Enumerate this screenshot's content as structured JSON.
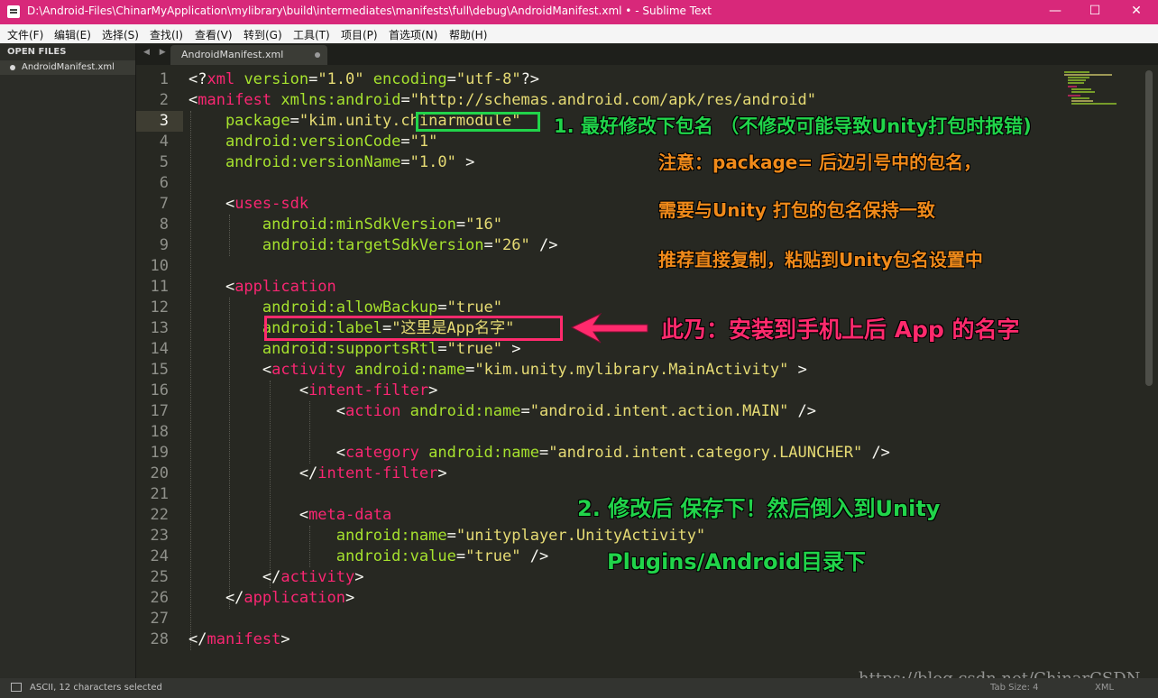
{
  "window": {
    "title": "D:\\Android-Files\\ChinarMyApplication\\mylibrary\\build\\intermediates\\manifests\\full\\debug\\AndroidManifest.xml • - Sublime Text",
    "minimize": "—",
    "maximize": "☐",
    "close": "✕"
  },
  "menu": {
    "items": [
      "文件(F)",
      "编辑(E)",
      "选择(S)",
      "查找(I)",
      "查看(V)",
      "转到(G)",
      "工具(T)",
      "项目(P)",
      "首选项(N)",
      "帮助(H)"
    ]
  },
  "sidebar": {
    "header": "OPEN FILES",
    "file": "AndroidManifest.xml"
  },
  "tabs": {
    "nav": "◀ ▶",
    "active": "AndroidManifest.xml"
  },
  "editor": {
    "line_numbers": [
      "1",
      "2",
      "3",
      "4",
      "5",
      "6",
      "7",
      "8",
      "9",
      "10",
      "11",
      "12",
      "13",
      "14",
      "15",
      "16",
      "17",
      "18",
      "19",
      "20",
      "21",
      "22",
      "23",
      "24",
      "25",
      "26",
      "27",
      "28"
    ],
    "current_line": "3",
    "lines": [
      [
        [
          "p",
          "<?"
        ],
        [
          "t",
          "xml"
        ],
        [
          "a",
          " version"
        ],
        [
          "p",
          "="
        ],
        [
          "s",
          "\"1.0\""
        ],
        [
          "a",
          " encoding"
        ],
        [
          "p",
          "="
        ],
        [
          "s",
          "\"utf-8\""
        ],
        [
          "p",
          "?>"
        ]
      ],
      [
        [
          "p",
          "<"
        ],
        [
          "t",
          "manifest"
        ],
        [
          "a",
          " xmlns:android"
        ],
        [
          "p",
          "="
        ],
        [
          "s",
          "\"http://schemas.android.com/apk/res/android\""
        ]
      ],
      [
        [
          "a",
          "    package"
        ],
        [
          "p",
          "="
        ],
        [
          "s",
          "\"kim.unity.chinarmodule\""
        ]
      ],
      [
        [
          "a",
          "    android:versionCode"
        ],
        [
          "p",
          "="
        ],
        [
          "s",
          "\"1\""
        ]
      ],
      [
        [
          "a",
          "    android:versionName"
        ],
        [
          "p",
          "="
        ],
        [
          "s",
          "\"1.0\""
        ],
        [
          "p",
          " >"
        ]
      ],
      [
        [
          "p",
          ""
        ]
      ],
      [
        [
          "p",
          "    <"
        ],
        [
          "t",
          "uses-sdk"
        ]
      ],
      [
        [
          "a",
          "        android:minSdkVersion"
        ],
        [
          "p",
          "="
        ],
        [
          "s",
          "\"16\""
        ]
      ],
      [
        [
          "a",
          "        android:targetSdkVersion"
        ],
        [
          "p",
          "="
        ],
        [
          "s",
          "\"26\""
        ],
        [
          "p",
          " />"
        ]
      ],
      [
        [
          "p",
          ""
        ]
      ],
      [
        [
          "p",
          "    <"
        ],
        [
          "t",
          "application"
        ]
      ],
      [
        [
          "a",
          "        android:allowBackup"
        ],
        [
          "p",
          "="
        ],
        [
          "s",
          "\"true\""
        ]
      ],
      [
        [
          "a",
          "        android:label"
        ],
        [
          "p",
          "="
        ],
        [
          "s",
          "\"这里是App名字\""
        ]
      ],
      [
        [
          "a",
          "        android:supportsRtl"
        ],
        [
          "p",
          "="
        ],
        [
          "s",
          "\"true\""
        ],
        [
          "p",
          " >"
        ]
      ],
      [
        [
          "p",
          "        <"
        ],
        [
          "t",
          "activity"
        ],
        [
          "a",
          " android:name"
        ],
        [
          "p",
          "="
        ],
        [
          "s",
          "\"kim.unity.mylibrary.MainActivity\""
        ],
        [
          "p",
          " >"
        ]
      ],
      [
        [
          "p",
          "            <"
        ],
        [
          "t",
          "intent-filter"
        ],
        [
          "p",
          ">"
        ]
      ],
      [
        [
          "p",
          "                <"
        ],
        [
          "t",
          "action"
        ],
        [
          "a",
          " android:name"
        ],
        [
          "p",
          "="
        ],
        [
          "s",
          "\"android.intent.action.MAIN\""
        ],
        [
          "p",
          " />"
        ]
      ],
      [
        [
          "p",
          ""
        ]
      ],
      [
        [
          "p",
          "                <"
        ],
        [
          "t",
          "category"
        ],
        [
          "a",
          " android:name"
        ],
        [
          "p",
          "="
        ],
        [
          "s",
          "\"android.intent.category.LAUNCHER\""
        ],
        [
          "p",
          " />"
        ]
      ],
      [
        [
          "p",
          "            </"
        ],
        [
          "t",
          "intent-filter"
        ],
        [
          "p",
          ">"
        ]
      ],
      [
        [
          "p",
          ""
        ]
      ],
      [
        [
          "p",
          "            <"
        ],
        [
          "t",
          "meta-data"
        ]
      ],
      [
        [
          "a",
          "                android:name"
        ],
        [
          "p",
          "="
        ],
        [
          "s",
          "\"unityplayer.UnityActivity\""
        ]
      ],
      [
        [
          "a",
          "                android:value"
        ],
        [
          "p",
          "="
        ],
        [
          "s",
          "\"true\""
        ],
        [
          "p",
          " />"
        ]
      ],
      [
        [
          "p",
          "        </"
        ],
        [
          "t",
          "activity"
        ],
        [
          "p",
          ">"
        ]
      ],
      [
        [
          "p",
          "    </"
        ],
        [
          "t",
          "application"
        ],
        [
          "p",
          ">"
        ]
      ],
      [
        [
          "p",
          ""
        ]
      ],
      [
        [
          "p",
          "</"
        ],
        [
          "t",
          "manifest"
        ],
        [
          "p",
          ">"
        ]
      ]
    ]
  },
  "annotations": {
    "note1": "1. 最好修改下包名 （不修改可能导致Unity打包时报错)",
    "orange1": "注意：package= 后边引号中的包名，",
    "orange2": "需要与Unity 打包的包名保持一致",
    "orange3": "推荐直接复制，粘贴到Unity包名设置中",
    "pink": "此乃：安装到手机上后 App 的名字",
    "note2a": "2. 修改后 保存下！然后倒入到Unity",
    "note2b": "Plugins/Android目录下",
    "colors": {
      "green": "#21d44a",
      "orange": "#f08a1a",
      "pink": "#ff2a6d"
    }
  },
  "status": {
    "selection": "ASCII, 12 characters selected",
    "tab_size": "Tab Size: 4",
    "syntax": "XML"
  },
  "watermark": "https://blog.csdn.net/ChinarCSDN",
  "theme": {
    "title_bar": "#d8287a",
    "editor_bg": "#272822"
  }
}
